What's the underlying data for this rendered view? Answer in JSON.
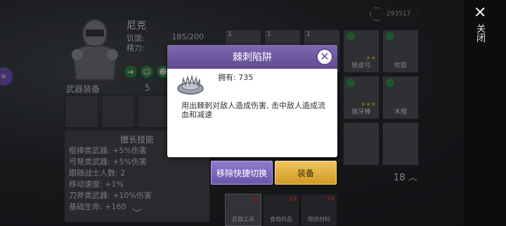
{
  "character": {
    "name": "尼克",
    "stats": [
      {
        "label": "饥饿:",
        "value": "185/200"
      },
      {
        "label": "精力:",
        "value": ""
      }
    ],
    "weapon_section_label": "武器装备",
    "weapon_count": "5"
  },
  "skills": {
    "title": "擅长技能",
    "lines": [
      "棍棒类武器: +5%伤害",
      "弓弩类武器: +5%伤害",
      "跟随战士人数: 2",
      "移动速度: +1%",
      "刀斧类武器: +10%伤害",
      "基础生命: +160"
    ]
  },
  "inventory": {
    "currency": "293517",
    "page_count": "18",
    "cells": [
      {
        "num": "1",
        "name": "",
        "green": false
      },
      {
        "num": "1",
        "name": "",
        "green": false
      },
      {
        "num": "1",
        "name": "",
        "green": false
      },
      {
        "num": "",
        "name": "铁皮弓",
        "green": true,
        "stars": "★★"
      },
      {
        "num": "",
        "name": "吹箭",
        "green": true
      },
      {
        "num": "",
        "name": "狼牙棒",
        "green": true,
        "stars": "★★★"
      },
      {
        "num": "",
        "name": "木棍",
        "green": true
      }
    ],
    "tabs": [
      {
        "label": "武器工具",
        "badge": "58",
        "active": true
      },
      {
        "label": "食物药品",
        "badge": "35",
        "active": false
      },
      {
        "label": "物资材料",
        "badge": "74",
        "active": false
      }
    ]
  },
  "close_label": "关闭",
  "modal": {
    "title": "棘刺陷阱",
    "owned": "拥有: 735",
    "description": "用出棘刺对敌人造成伤害, 击中敌人造成流血和减速",
    "item_icon": "spike-trap-icon"
  },
  "buttons": {
    "switch_label": "移除快捷切换",
    "equip_label": "装备"
  },
  "colors": {
    "modal_header": "#6f5aa2",
    "switch_button": "#7b67bf",
    "equip_button": "#e0b040"
  }
}
